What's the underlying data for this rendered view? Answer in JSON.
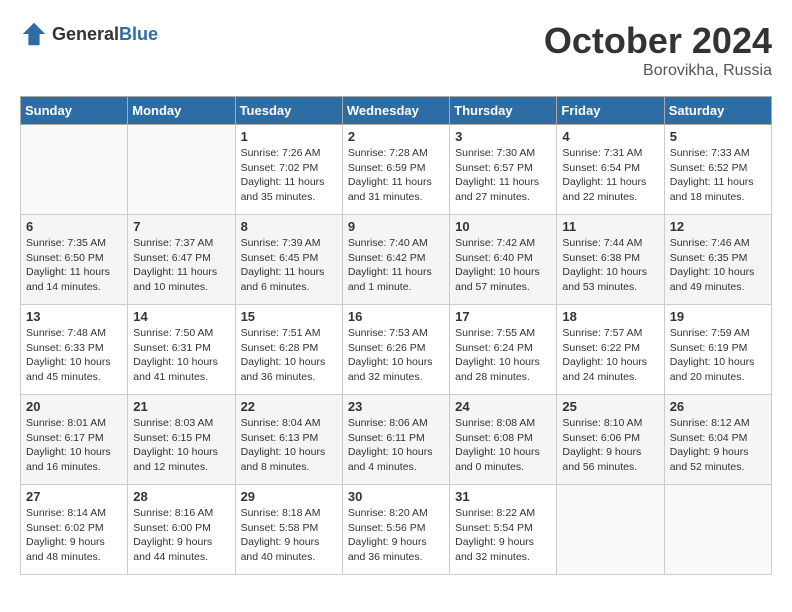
{
  "header": {
    "logo_general": "General",
    "logo_blue": "Blue",
    "month": "October 2024",
    "location": "Borovikha, Russia"
  },
  "weekdays": [
    "Sunday",
    "Monday",
    "Tuesday",
    "Wednesday",
    "Thursday",
    "Friday",
    "Saturday"
  ],
  "weeks": [
    [
      {
        "day": "",
        "detail": ""
      },
      {
        "day": "",
        "detail": ""
      },
      {
        "day": "1",
        "detail": "Sunrise: 7:26 AM\nSunset: 7:02 PM\nDaylight: 11 hours\nand 35 minutes."
      },
      {
        "day": "2",
        "detail": "Sunrise: 7:28 AM\nSunset: 6:59 PM\nDaylight: 11 hours\nand 31 minutes."
      },
      {
        "day": "3",
        "detail": "Sunrise: 7:30 AM\nSunset: 6:57 PM\nDaylight: 11 hours\nand 27 minutes."
      },
      {
        "day": "4",
        "detail": "Sunrise: 7:31 AM\nSunset: 6:54 PM\nDaylight: 11 hours\nand 22 minutes."
      },
      {
        "day": "5",
        "detail": "Sunrise: 7:33 AM\nSunset: 6:52 PM\nDaylight: 11 hours\nand 18 minutes."
      }
    ],
    [
      {
        "day": "6",
        "detail": "Sunrise: 7:35 AM\nSunset: 6:50 PM\nDaylight: 11 hours\nand 14 minutes."
      },
      {
        "day": "7",
        "detail": "Sunrise: 7:37 AM\nSunset: 6:47 PM\nDaylight: 11 hours\nand 10 minutes."
      },
      {
        "day": "8",
        "detail": "Sunrise: 7:39 AM\nSunset: 6:45 PM\nDaylight: 11 hours\nand 6 minutes."
      },
      {
        "day": "9",
        "detail": "Sunrise: 7:40 AM\nSunset: 6:42 PM\nDaylight: 11 hours\nand 1 minute."
      },
      {
        "day": "10",
        "detail": "Sunrise: 7:42 AM\nSunset: 6:40 PM\nDaylight: 10 hours\nand 57 minutes."
      },
      {
        "day": "11",
        "detail": "Sunrise: 7:44 AM\nSunset: 6:38 PM\nDaylight: 10 hours\nand 53 minutes."
      },
      {
        "day": "12",
        "detail": "Sunrise: 7:46 AM\nSunset: 6:35 PM\nDaylight: 10 hours\nand 49 minutes."
      }
    ],
    [
      {
        "day": "13",
        "detail": "Sunrise: 7:48 AM\nSunset: 6:33 PM\nDaylight: 10 hours\nand 45 minutes."
      },
      {
        "day": "14",
        "detail": "Sunrise: 7:50 AM\nSunset: 6:31 PM\nDaylight: 10 hours\nand 41 minutes."
      },
      {
        "day": "15",
        "detail": "Sunrise: 7:51 AM\nSunset: 6:28 PM\nDaylight: 10 hours\nand 36 minutes."
      },
      {
        "day": "16",
        "detail": "Sunrise: 7:53 AM\nSunset: 6:26 PM\nDaylight: 10 hours\nand 32 minutes."
      },
      {
        "day": "17",
        "detail": "Sunrise: 7:55 AM\nSunset: 6:24 PM\nDaylight: 10 hours\nand 28 minutes."
      },
      {
        "day": "18",
        "detail": "Sunrise: 7:57 AM\nSunset: 6:22 PM\nDaylight: 10 hours\nand 24 minutes."
      },
      {
        "day": "19",
        "detail": "Sunrise: 7:59 AM\nSunset: 6:19 PM\nDaylight: 10 hours\nand 20 minutes."
      }
    ],
    [
      {
        "day": "20",
        "detail": "Sunrise: 8:01 AM\nSunset: 6:17 PM\nDaylight: 10 hours\nand 16 minutes."
      },
      {
        "day": "21",
        "detail": "Sunrise: 8:03 AM\nSunset: 6:15 PM\nDaylight: 10 hours\nand 12 minutes."
      },
      {
        "day": "22",
        "detail": "Sunrise: 8:04 AM\nSunset: 6:13 PM\nDaylight: 10 hours\nand 8 minutes."
      },
      {
        "day": "23",
        "detail": "Sunrise: 8:06 AM\nSunset: 6:11 PM\nDaylight: 10 hours\nand 4 minutes."
      },
      {
        "day": "24",
        "detail": "Sunrise: 8:08 AM\nSunset: 6:08 PM\nDaylight: 10 hours\nand 0 minutes."
      },
      {
        "day": "25",
        "detail": "Sunrise: 8:10 AM\nSunset: 6:06 PM\nDaylight: 9 hours\nand 56 minutes."
      },
      {
        "day": "26",
        "detail": "Sunrise: 8:12 AM\nSunset: 6:04 PM\nDaylight: 9 hours\nand 52 minutes."
      }
    ],
    [
      {
        "day": "27",
        "detail": "Sunrise: 8:14 AM\nSunset: 6:02 PM\nDaylight: 9 hours\nand 48 minutes."
      },
      {
        "day": "28",
        "detail": "Sunrise: 8:16 AM\nSunset: 6:00 PM\nDaylight: 9 hours\nand 44 minutes."
      },
      {
        "day": "29",
        "detail": "Sunrise: 8:18 AM\nSunset: 5:58 PM\nDaylight: 9 hours\nand 40 minutes."
      },
      {
        "day": "30",
        "detail": "Sunrise: 8:20 AM\nSunset: 5:56 PM\nDaylight: 9 hours\nand 36 minutes."
      },
      {
        "day": "31",
        "detail": "Sunrise: 8:22 AM\nSunset: 5:54 PM\nDaylight: 9 hours\nand 32 minutes."
      },
      {
        "day": "",
        "detail": ""
      },
      {
        "day": "",
        "detail": ""
      }
    ]
  ]
}
